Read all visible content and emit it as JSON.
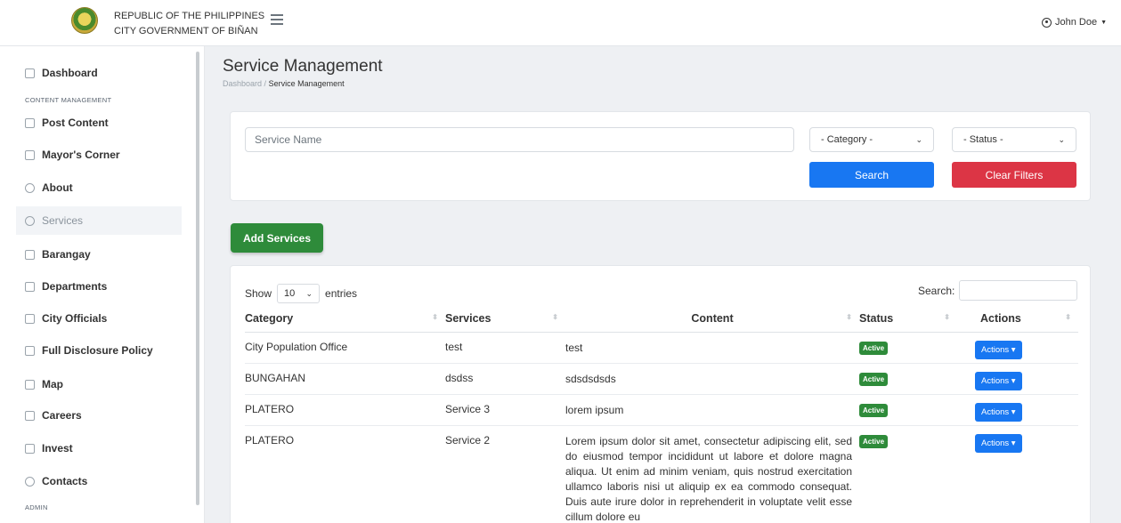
{
  "header": {
    "brand_line1": "REPUBLIC OF THE PHILIPPINES",
    "brand_line2": "CITY GOVERNMENT OF BIÑAN",
    "user_name": "John Doe"
  },
  "sidebar": {
    "items": [
      {
        "label": "Dashboard",
        "icon": "grid-icon"
      },
      {
        "label": "Post Content",
        "icon": "image-icon"
      },
      {
        "label": "Mayor's Corner",
        "icon": "person-icon"
      },
      {
        "label": "About",
        "icon": "info-icon"
      },
      {
        "label": "Services",
        "icon": "check-circle-icon"
      },
      {
        "label": "Barangay",
        "icon": "copy-icon"
      },
      {
        "label": "Departments",
        "icon": "building-icon"
      },
      {
        "label": "City Officials",
        "icon": "people-icon"
      },
      {
        "label": "Full Disclosure Policy",
        "icon": "list-icon"
      },
      {
        "label": "Map",
        "icon": "map-icon"
      },
      {
        "label": "Careers",
        "icon": "briefcase-icon"
      },
      {
        "label": "Invest",
        "icon": "cash-icon"
      },
      {
        "label": "Contacts",
        "icon": "phone-icon"
      }
    ],
    "section_content": "CONTENT MANAGEMENT",
    "section_admin": "ADMIN"
  },
  "page": {
    "title": "Service Management",
    "breadcrumb_home": "Dashboard",
    "breadcrumb_sep": "/",
    "breadcrumb_current": "Service Management"
  },
  "filters": {
    "service_placeholder": "Service Name",
    "category": "- Category -",
    "status": "- Status -",
    "search_label": "Search",
    "clear_label": "Clear Filters"
  },
  "add_button": "Add Services",
  "table": {
    "show_label": "Show",
    "entries_value": "10",
    "entries_label": "entries",
    "search_label": "Search:",
    "columns": [
      "Category",
      "Services",
      "Content",
      "Status",
      "Actions"
    ],
    "rows": [
      {
        "category": "City Population Office",
        "service": "test",
        "content": "test",
        "status": "Active",
        "action": "Actions"
      },
      {
        "category": "BUNGAHAN",
        "service": "dsdss",
        "content": "sdsdsdsds",
        "status": "Active",
        "action": "Actions"
      },
      {
        "category": "PLATERO",
        "service": "Service 3",
        "content": "lorem ipsum",
        "status": "Active",
        "action": "Actions"
      },
      {
        "category": "PLATERO",
        "service": "Service 2",
        "content": "Lorem ipsum dolor sit amet, consectetur adipiscing elit, sed do eiusmod tempor incididunt ut labore et dolore magna aliqua. Ut enim ad minim veniam, quis nostrud exercitation ullamco laboris nisi ut aliquip ex ea commodo consequat. Duis aute irure dolor in reprehenderit in voluptate velit esse cillum dolore eu",
        "status": "Active",
        "action": "Actions"
      }
    ]
  },
  "colors": {
    "primary": "#1877f2",
    "danger": "#dc3545",
    "success": "#2e8b3a"
  }
}
